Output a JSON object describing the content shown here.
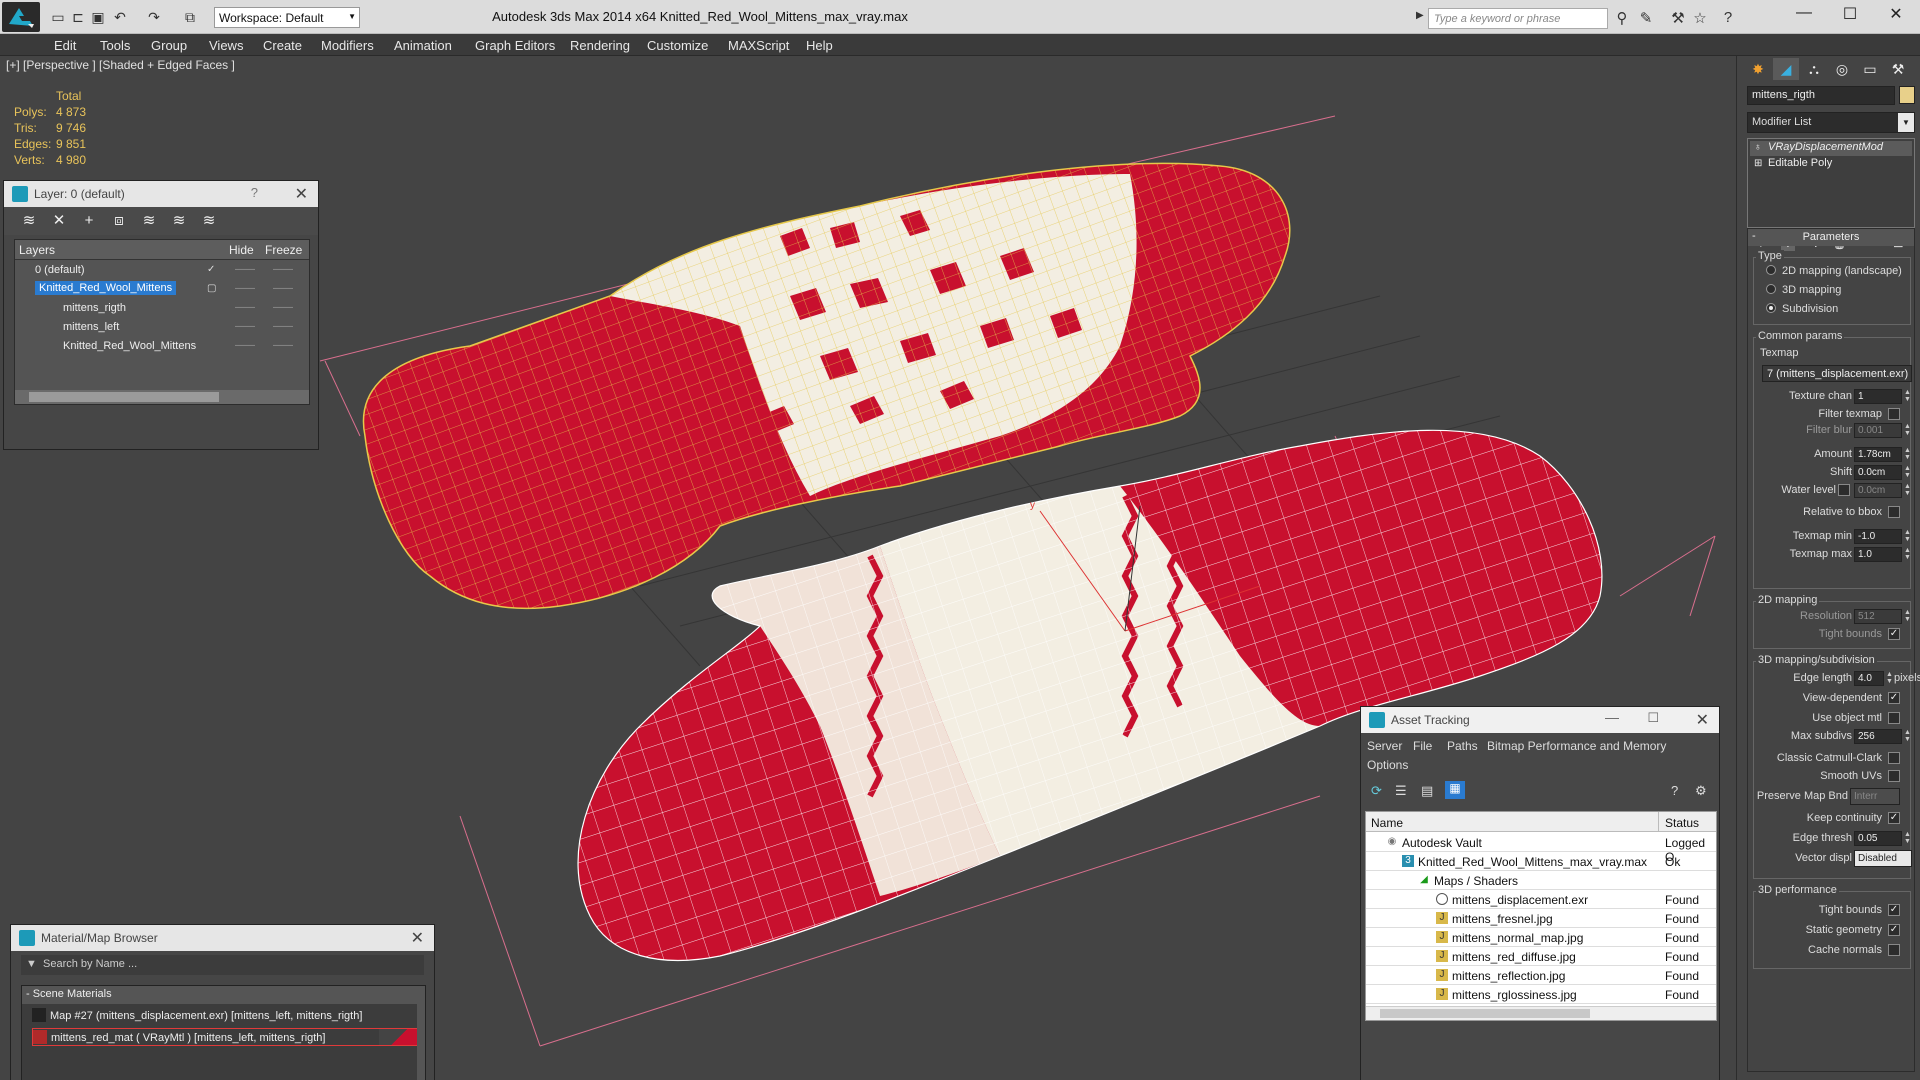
{
  "app": {
    "title": "Autodesk 3ds Max  2014 x64      Knitted_Red_Wool_Mittens_max_vray.max",
    "workspace": "Workspace: Default",
    "search_placeholder": "Type a keyword or phrase"
  },
  "menu": [
    "Edit",
    "Tools",
    "Group",
    "Views",
    "Create",
    "Modifiers",
    "Animation",
    "Graph Editors",
    "Rendering",
    "Customize",
    "MAXScript",
    "Help"
  ],
  "viewport": {
    "label": "[+] [Perspective ] [Shaded + Edged Faces ]",
    "stats": {
      "total_label": "Total",
      "rows": [
        {
          "k": "Polys:",
          "v": "4 873"
        },
        {
          "k": "Tris:",
          "v": "9 746"
        },
        {
          "k": "Edges:",
          "v": "9 851"
        },
        {
          "k": "Verts:",
          "v": "4 980"
        }
      ]
    }
  },
  "layer_panel": {
    "title": "Layer: 0 (default)",
    "help": "?",
    "col_layers": "Layers",
    "col_hide": "Hide",
    "col_freeze": "Freeze",
    "rows": [
      {
        "name": "0 (default)"
      },
      {
        "name": "Knitted_Red_Wool_Mittens"
      },
      {
        "name": "mittens_rigth"
      },
      {
        "name": "mittens_left"
      },
      {
        "name": "Knitted_Red_Wool_Mittens"
      }
    ]
  },
  "material_browser": {
    "title": "Material/Map Browser",
    "search": "Search by Name ...",
    "section": "- Scene Materials",
    "items": [
      "Map #27 (mittens_displacement.exr)  [mittens_left, mittens_rigth]",
      "mittens_red_mat  ( VRayMtl )  [mittens_left, mittens_rigth]"
    ]
  },
  "asset_tracking": {
    "title": "Asset Tracking",
    "menu": [
      "Server",
      "File",
      "Paths",
      "Bitmap Performance and Memory",
      "Options"
    ],
    "col_name": "Name",
    "col_status": "Status",
    "rows": [
      {
        "name": "Autodesk Vault",
        "status": "Logged O"
      },
      {
        "name": "Knitted_Red_Wool_Mittens_max_vray.max",
        "status": "Ok"
      },
      {
        "name": "Maps / Shaders",
        "status": ""
      },
      {
        "name": "mittens_displacement.exr",
        "status": "Found"
      },
      {
        "name": "mittens_fresnel.jpg",
        "status": "Found"
      },
      {
        "name": "mittens_normal_map.jpg",
        "status": "Found"
      },
      {
        "name": "mittens_red_diffuse.jpg",
        "status": "Found"
      },
      {
        "name": "mittens_reflection.jpg",
        "status": "Found"
      },
      {
        "name": "mittens_rglossiness.jpg",
        "status": "Found"
      }
    ]
  },
  "command_panel": {
    "object_name": "mittens_rigth",
    "modifier_list": "Modifier List",
    "stack": [
      "VRayDisplacementMod",
      "Editable Poly"
    ],
    "params_title": "Parameters",
    "type_label": "Type",
    "radios": [
      "2D mapping (landscape)",
      "3D mapping",
      "Subdivision"
    ],
    "common_label": "Common params",
    "texmap_label": "Texmap",
    "texmap_value": "7 (mittens_displacement.exr)",
    "texture_chan_label": "Texture chan",
    "texture_chan": "1",
    "filter_texmap": "Filter texmap",
    "filter_blur_label": "Filter blur",
    "filter_blur": "0.001",
    "amount_label": "Amount",
    "amount": "1.78cm",
    "shift_label": "Shift",
    "shift": "0.0cm",
    "water_label": "Water level",
    "water": "0.0cm",
    "relative_bbox": "Relative to bbox",
    "texmap_min_label": "Texmap min",
    "texmap_min": "-1.0",
    "texmap_max_label": "Texmap max",
    "texmap_max": "1.0",
    "group_2d": "2D mapping",
    "resolution_label": "Resolution",
    "resolution": "512",
    "tight_bounds_2d": "Tight bounds",
    "group_3d": "3D mapping/subdivision",
    "edge_length_label": "Edge length",
    "edge_length": "4.0",
    "pixels": "pixels",
    "view_dependent": "View-dependent",
    "use_object_mtl": "Use object mtl",
    "max_subdivs_label": "Max subdivs",
    "max_subdivs": "256",
    "classic_catmull": "Classic Catmull-Clark",
    "smooth_uvs": "Smooth UVs",
    "preserve_map_bnd": "Preserve Map Bnd",
    "preserve_value": "Interr",
    "keep_continuity": "Keep continuity",
    "edge_thresh_label": "Edge thresh",
    "edge_thresh": "0.05",
    "vector_displ_label": "Vector displ",
    "vector_displ": "Disabled",
    "group_perf": "3D performance",
    "tight_bounds": "Tight bounds",
    "static_geometry": "Static geometry",
    "cache_normals": "Cache normals",
    "check": "✓"
  },
  "colors": {
    "accent": "#2a7bd0",
    "viewport_bg": "#444444",
    "mitten_red": "#c8102e",
    "mitten_cream": "#f3eee2",
    "wire_yellow": "#e6c84a"
  }
}
